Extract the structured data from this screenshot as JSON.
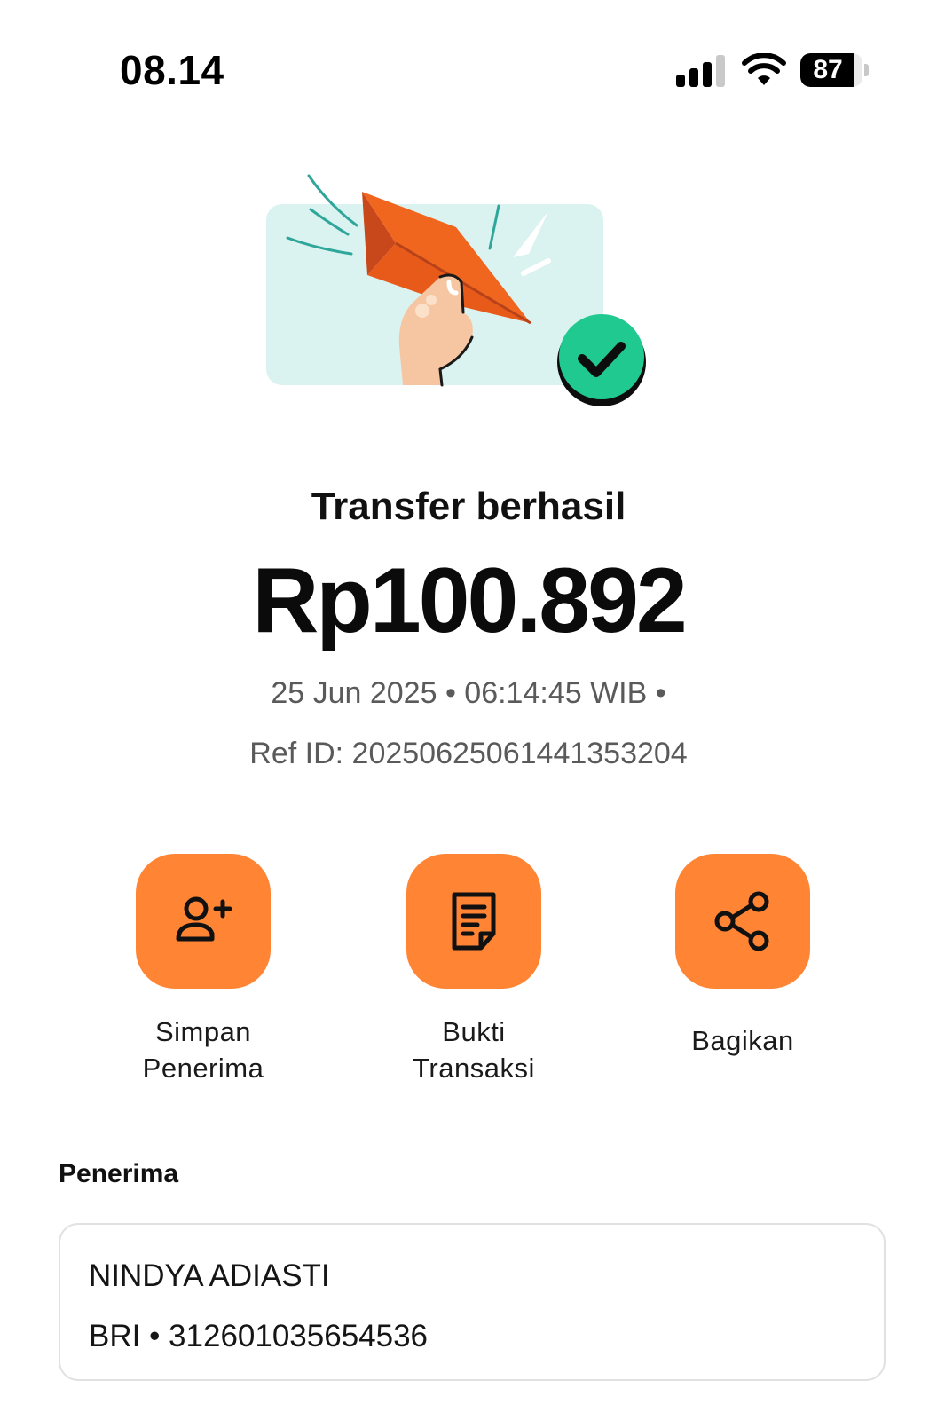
{
  "status_bar": {
    "time": "08.14",
    "battery_level": "87",
    "battery_fraction": 0.87
  },
  "illustration": {
    "icon": "paper-plane-hand-illustration",
    "success_badge_icon": "check-circle-icon"
  },
  "result": {
    "title": "Transfer berhasil",
    "amount": "Rp100.892",
    "datetime_line": "25 Jun 2025 • 06:14:45 WIB •",
    "ref_line": "Ref ID: 20250625061441353204"
  },
  "actions": [
    {
      "label_line1": "Simpan",
      "label_line2": "Penerima",
      "icon": "add-user-icon"
    },
    {
      "label_line1": "Bukti",
      "label_line2": "Transaksi",
      "icon": "receipt-icon"
    },
    {
      "label": "Bagikan",
      "icon": "share-icon"
    }
  ],
  "recipient": {
    "section_title": "Penerima",
    "name": "NINDYA ADIASTI",
    "account": "BRI • 312601035654536"
  },
  "colors": {
    "accent": "#ff8434",
    "success": "#1fc98f",
    "illustration_bg": "#daf3f0",
    "plane": "#f0661f"
  }
}
